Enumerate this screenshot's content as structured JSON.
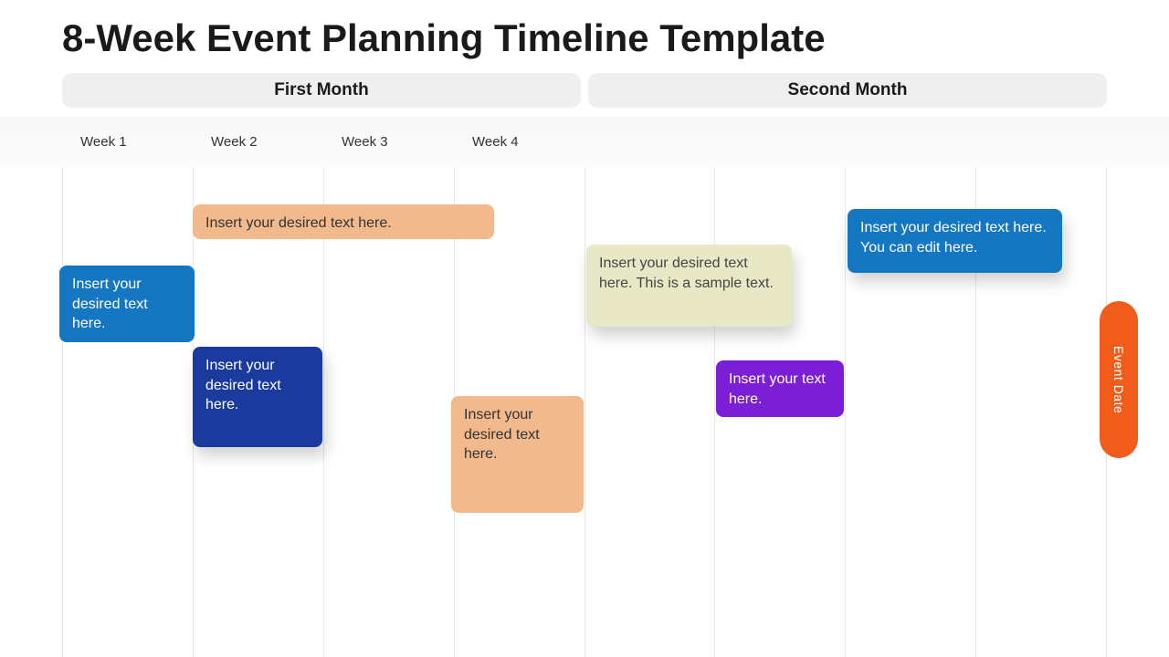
{
  "title": "8-Week Event Planning Timeline Template",
  "months": {
    "first": "First Month",
    "second": "Second Month"
  },
  "weeks": [
    "Week 1",
    "Week 2",
    "Week 3",
    "Week 4",
    "",
    "",
    "",
    ""
  ],
  "cards": {
    "peach_wide": "Insert your desired text here.",
    "blue_small": "Insert your desired text here.",
    "navy": "Insert your desired text here.",
    "peach_sq": "Insert your desired text here.",
    "olive": "Insert your desired text here. This is a sample text.",
    "purple": "Insert your text here.",
    "blue_right": "Insert your desired text here. You can edit here."
  },
  "event_date": "Event Date",
  "colors": {
    "peach": "#f2b98c",
    "blue": "#1576c2",
    "navy": "#1a3a9e",
    "olive": "#e8e8c6",
    "purple": "#7a1fd6",
    "orange": "#f25c1a"
  }
}
